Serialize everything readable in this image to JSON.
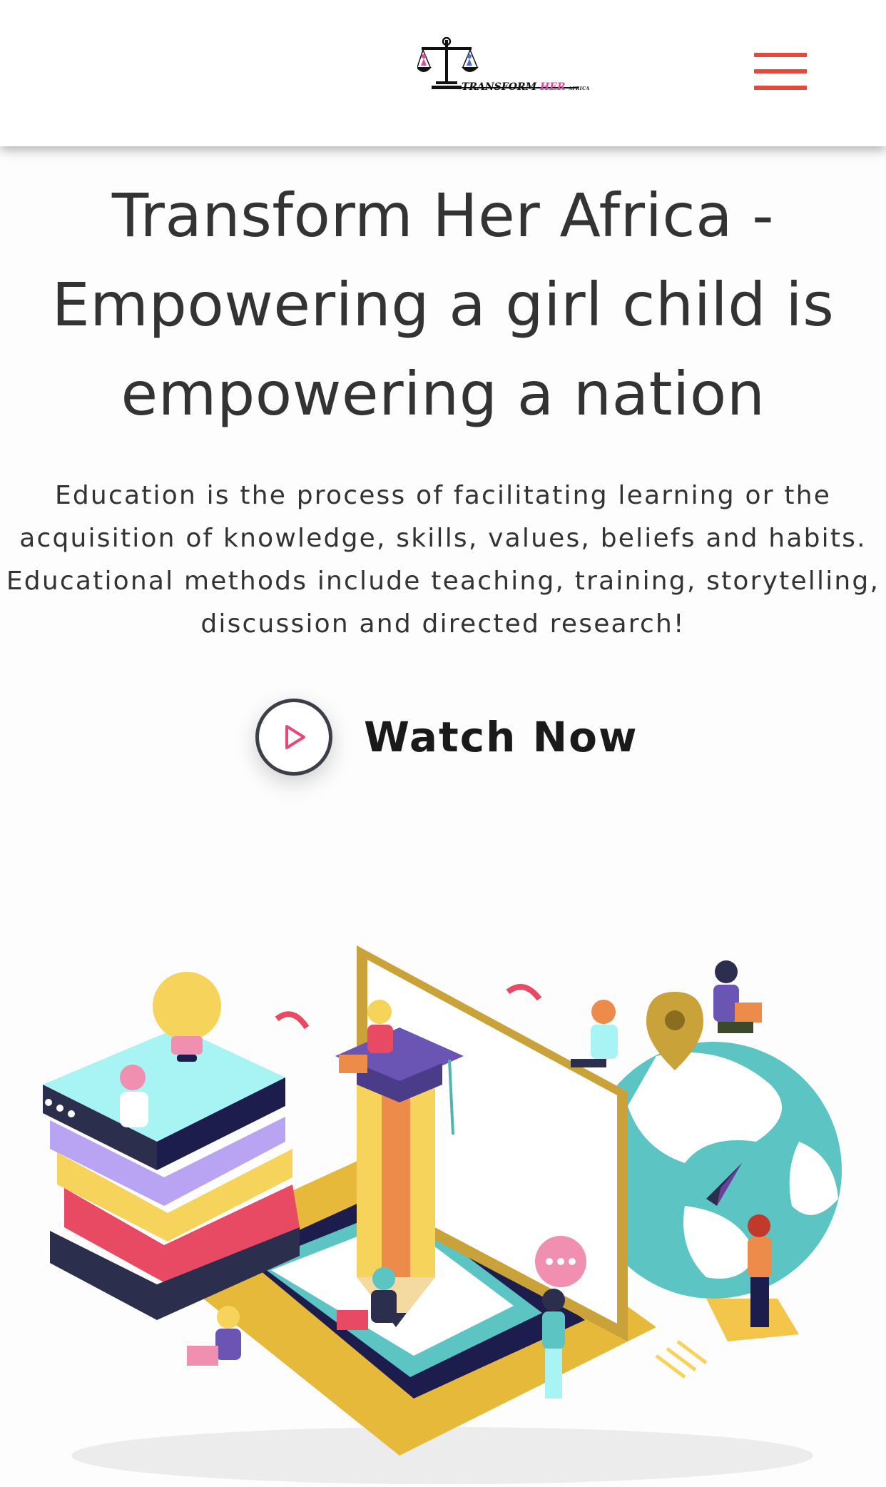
{
  "header": {
    "logo_text": "TRANSFORM",
    "logo_text_highlight": "HER",
    "logo_text_small": "AFRICA"
  },
  "hero": {
    "title": "Transform Her Africa - Empowering a girl child is empowering a nation",
    "description": "Education is the process of facilitating learning or the acquisition of knowledge, skills, values, beliefs and habits. Educational methods include teaching, training, storytelling, discussion and directed research!",
    "watch_label": "Watch Now"
  },
  "icons": {
    "logo": "scales-of-justice-icon",
    "menu": "hamburger-menu-icon",
    "play": "play-icon"
  },
  "colors": {
    "menu_accent": "#e24b3b",
    "play_triangle": "#e64a74",
    "brand_pink": "#e0479e"
  }
}
